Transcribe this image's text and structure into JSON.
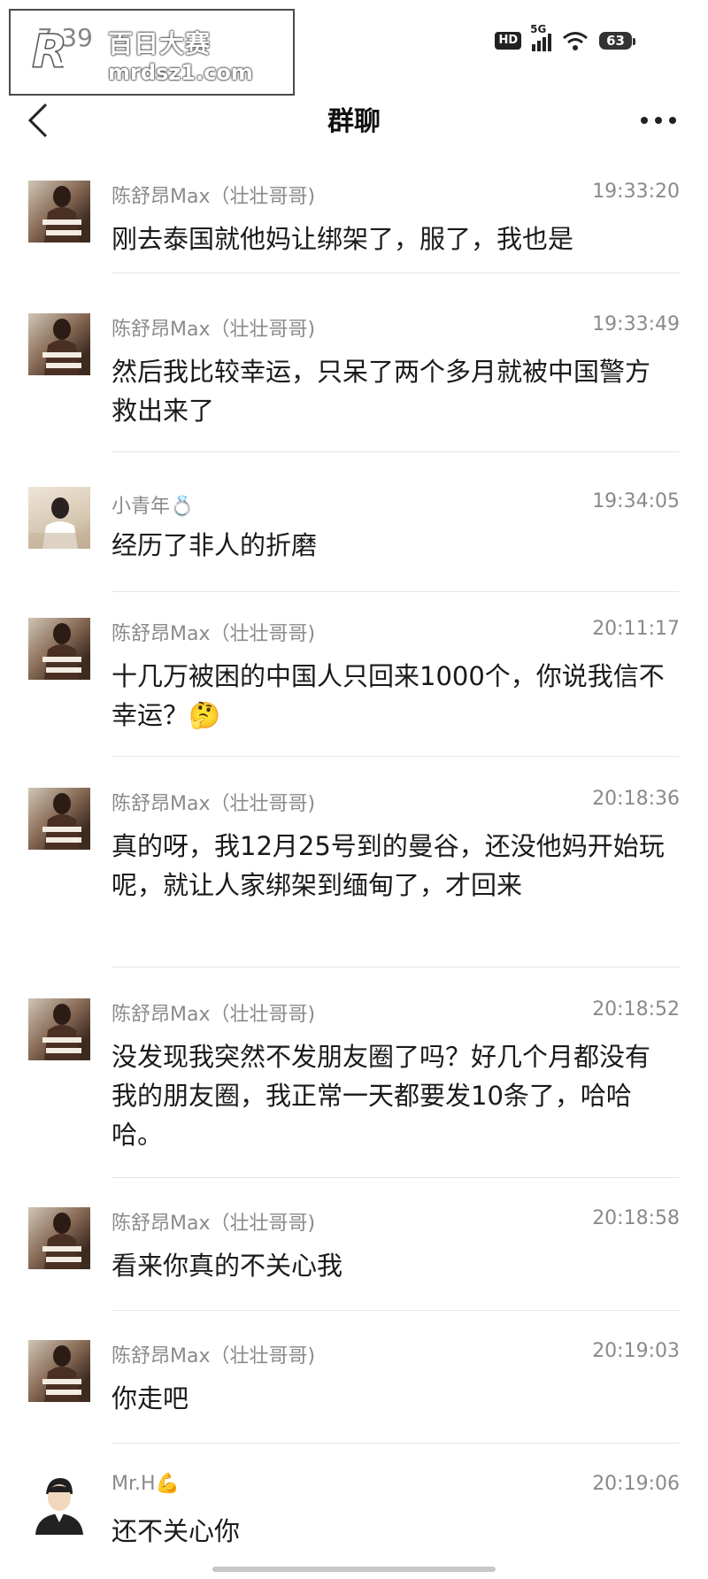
{
  "status_bar": {
    "time": "7:39",
    "hd": "HD",
    "network": "5G",
    "battery": "63"
  },
  "watermark": {
    "logo_letter": "R",
    "title": "百日大赛",
    "url": "mrdsz1.com"
  },
  "header": {
    "title": "群聊"
  },
  "messages": [
    {
      "sender": "陈舒昂Max（壮壮哥哥)",
      "time": "19:33:20",
      "text": "刚去泰国就他妈让绑架了，服了，我也是"
    },
    {
      "sender": "陈舒昂Max（壮壮哥哥)",
      "time": "19:33:49",
      "text": "然后我比较幸运，只呆了两个多月就被中国警方救出来了"
    },
    {
      "sender": "小青年💍",
      "time": "19:34:05",
      "text": "经历了非人的折磨"
    },
    {
      "sender": "陈舒昂Max（壮壮哥哥)",
      "time": "20:11:17",
      "text": "十几万被困的中国人只回来1000个，你说我信不幸运？🤔"
    },
    {
      "sender": "陈舒昂Max（壮壮哥哥)",
      "time": "20:18:36",
      "text": "真的呀，我12月25号到的曼谷，还没他妈开始玩呢，就让人家绑架到缅甸了，才回来"
    },
    {
      "sender": "陈舒昂Max（壮壮哥哥)",
      "time": "20:18:52",
      "text": "没发现我突然不发朋友圈了吗？好几个月都没有我的朋友圈，我正常一天都要发10条了，哈哈哈。"
    },
    {
      "sender": "陈舒昂Max（壮壮哥哥)",
      "time": "20:18:58",
      "text": "看来你真的不关心我"
    },
    {
      "sender": "陈舒昂Max（壮壮哥哥)",
      "time": "20:19:03",
      "text": "你走吧"
    },
    {
      "sender": "Mr.H💪",
      "time": "20:19:06",
      "text": "还不关心你"
    }
  ]
}
